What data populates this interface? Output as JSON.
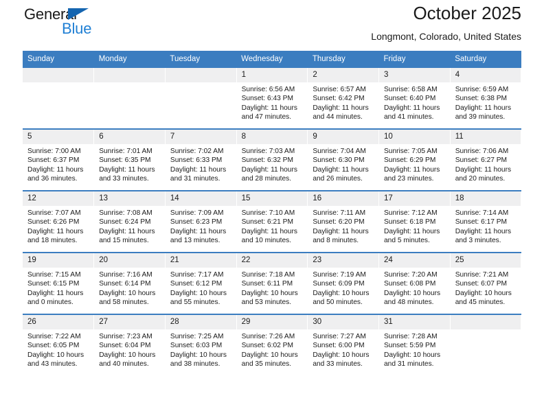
{
  "brand": {
    "word_one": "General",
    "word_two": "Blue",
    "triangle_icon": "triangle-icon"
  },
  "header": {
    "title": "October 2025",
    "subtitle": "Longmont, Colorado, United States"
  },
  "colors": {
    "header_blue": "#3b7dc0",
    "brand_blue": "#1f7fd4",
    "daynum_band": "#efeff0",
    "text": "#1a1a1a"
  },
  "calendar": {
    "weekday_headers": [
      "Sunday",
      "Monday",
      "Tuesday",
      "Wednesday",
      "Thursday",
      "Friday",
      "Saturday"
    ],
    "labels": {
      "sunrise": "Sunrise:",
      "sunset": "Sunset:",
      "daylight": "Daylight:"
    },
    "weeks": [
      [
        {
          "day": "",
          "sunrise": "",
          "sunset": "",
          "daylight_line1": "",
          "daylight_line2": ""
        },
        {
          "day": "",
          "sunrise": "",
          "sunset": "",
          "daylight_line1": "",
          "daylight_line2": ""
        },
        {
          "day": "",
          "sunrise": "",
          "sunset": "",
          "daylight_line1": "",
          "daylight_line2": ""
        },
        {
          "day": "1",
          "sunrise": "Sunrise: 6:56 AM",
          "sunset": "Sunset: 6:43 PM",
          "daylight_line1": "Daylight: 11 hours",
          "daylight_line2": "and 47 minutes."
        },
        {
          "day": "2",
          "sunrise": "Sunrise: 6:57 AM",
          "sunset": "Sunset: 6:42 PM",
          "daylight_line1": "Daylight: 11 hours",
          "daylight_line2": "and 44 minutes."
        },
        {
          "day": "3",
          "sunrise": "Sunrise: 6:58 AM",
          "sunset": "Sunset: 6:40 PM",
          "daylight_line1": "Daylight: 11 hours",
          "daylight_line2": "and 41 minutes."
        },
        {
          "day": "4",
          "sunrise": "Sunrise: 6:59 AM",
          "sunset": "Sunset: 6:38 PM",
          "daylight_line1": "Daylight: 11 hours",
          "daylight_line2": "and 39 minutes."
        }
      ],
      [
        {
          "day": "5",
          "sunrise": "Sunrise: 7:00 AM",
          "sunset": "Sunset: 6:37 PM",
          "daylight_line1": "Daylight: 11 hours",
          "daylight_line2": "and 36 minutes."
        },
        {
          "day": "6",
          "sunrise": "Sunrise: 7:01 AM",
          "sunset": "Sunset: 6:35 PM",
          "daylight_line1": "Daylight: 11 hours",
          "daylight_line2": "and 33 minutes."
        },
        {
          "day": "7",
          "sunrise": "Sunrise: 7:02 AM",
          "sunset": "Sunset: 6:33 PM",
          "daylight_line1": "Daylight: 11 hours",
          "daylight_line2": "and 31 minutes."
        },
        {
          "day": "8",
          "sunrise": "Sunrise: 7:03 AM",
          "sunset": "Sunset: 6:32 PM",
          "daylight_line1": "Daylight: 11 hours",
          "daylight_line2": "and 28 minutes."
        },
        {
          "day": "9",
          "sunrise": "Sunrise: 7:04 AM",
          "sunset": "Sunset: 6:30 PM",
          "daylight_line1": "Daylight: 11 hours",
          "daylight_line2": "and 26 minutes."
        },
        {
          "day": "10",
          "sunrise": "Sunrise: 7:05 AM",
          "sunset": "Sunset: 6:29 PM",
          "daylight_line1": "Daylight: 11 hours",
          "daylight_line2": "and 23 minutes."
        },
        {
          "day": "11",
          "sunrise": "Sunrise: 7:06 AM",
          "sunset": "Sunset: 6:27 PM",
          "daylight_line1": "Daylight: 11 hours",
          "daylight_line2": "and 20 minutes."
        }
      ],
      [
        {
          "day": "12",
          "sunrise": "Sunrise: 7:07 AM",
          "sunset": "Sunset: 6:26 PM",
          "daylight_line1": "Daylight: 11 hours",
          "daylight_line2": "and 18 minutes."
        },
        {
          "day": "13",
          "sunrise": "Sunrise: 7:08 AM",
          "sunset": "Sunset: 6:24 PM",
          "daylight_line1": "Daylight: 11 hours",
          "daylight_line2": "and 15 minutes."
        },
        {
          "day": "14",
          "sunrise": "Sunrise: 7:09 AM",
          "sunset": "Sunset: 6:23 PM",
          "daylight_line1": "Daylight: 11 hours",
          "daylight_line2": "and 13 minutes."
        },
        {
          "day": "15",
          "sunrise": "Sunrise: 7:10 AM",
          "sunset": "Sunset: 6:21 PM",
          "daylight_line1": "Daylight: 11 hours",
          "daylight_line2": "and 10 minutes."
        },
        {
          "day": "16",
          "sunrise": "Sunrise: 7:11 AM",
          "sunset": "Sunset: 6:20 PM",
          "daylight_line1": "Daylight: 11 hours",
          "daylight_line2": "and 8 minutes."
        },
        {
          "day": "17",
          "sunrise": "Sunrise: 7:12 AM",
          "sunset": "Sunset: 6:18 PM",
          "daylight_line1": "Daylight: 11 hours",
          "daylight_line2": "and 5 minutes."
        },
        {
          "day": "18",
          "sunrise": "Sunrise: 7:14 AM",
          "sunset": "Sunset: 6:17 PM",
          "daylight_line1": "Daylight: 11 hours",
          "daylight_line2": "and 3 minutes."
        }
      ],
      [
        {
          "day": "19",
          "sunrise": "Sunrise: 7:15 AM",
          "sunset": "Sunset: 6:15 PM",
          "daylight_line1": "Daylight: 11 hours",
          "daylight_line2": "and 0 minutes."
        },
        {
          "day": "20",
          "sunrise": "Sunrise: 7:16 AM",
          "sunset": "Sunset: 6:14 PM",
          "daylight_line1": "Daylight: 10 hours",
          "daylight_line2": "and 58 minutes."
        },
        {
          "day": "21",
          "sunrise": "Sunrise: 7:17 AM",
          "sunset": "Sunset: 6:12 PM",
          "daylight_line1": "Daylight: 10 hours",
          "daylight_line2": "and 55 minutes."
        },
        {
          "day": "22",
          "sunrise": "Sunrise: 7:18 AM",
          "sunset": "Sunset: 6:11 PM",
          "daylight_line1": "Daylight: 10 hours",
          "daylight_line2": "and 53 minutes."
        },
        {
          "day": "23",
          "sunrise": "Sunrise: 7:19 AM",
          "sunset": "Sunset: 6:09 PM",
          "daylight_line1": "Daylight: 10 hours",
          "daylight_line2": "and 50 minutes."
        },
        {
          "day": "24",
          "sunrise": "Sunrise: 7:20 AM",
          "sunset": "Sunset: 6:08 PM",
          "daylight_line1": "Daylight: 10 hours",
          "daylight_line2": "and 48 minutes."
        },
        {
          "day": "25",
          "sunrise": "Sunrise: 7:21 AM",
          "sunset": "Sunset: 6:07 PM",
          "daylight_line1": "Daylight: 10 hours",
          "daylight_line2": "and 45 minutes."
        }
      ],
      [
        {
          "day": "26",
          "sunrise": "Sunrise: 7:22 AM",
          "sunset": "Sunset: 6:05 PM",
          "daylight_line1": "Daylight: 10 hours",
          "daylight_line2": "and 43 minutes."
        },
        {
          "day": "27",
          "sunrise": "Sunrise: 7:23 AM",
          "sunset": "Sunset: 6:04 PM",
          "daylight_line1": "Daylight: 10 hours",
          "daylight_line2": "and 40 minutes."
        },
        {
          "day": "28",
          "sunrise": "Sunrise: 7:25 AM",
          "sunset": "Sunset: 6:03 PM",
          "daylight_line1": "Daylight: 10 hours",
          "daylight_line2": "and 38 minutes."
        },
        {
          "day": "29",
          "sunrise": "Sunrise: 7:26 AM",
          "sunset": "Sunset: 6:02 PM",
          "daylight_line1": "Daylight: 10 hours",
          "daylight_line2": "and 35 minutes."
        },
        {
          "day": "30",
          "sunrise": "Sunrise: 7:27 AM",
          "sunset": "Sunset: 6:00 PM",
          "daylight_line1": "Daylight: 10 hours",
          "daylight_line2": "and 33 minutes."
        },
        {
          "day": "31",
          "sunrise": "Sunrise: 7:28 AM",
          "sunset": "Sunset: 5:59 PM",
          "daylight_line1": "Daylight: 10 hours",
          "daylight_line2": "and 31 minutes."
        },
        {
          "day": "",
          "sunrise": "",
          "sunset": "",
          "daylight_line1": "",
          "daylight_line2": ""
        }
      ]
    ]
  }
}
